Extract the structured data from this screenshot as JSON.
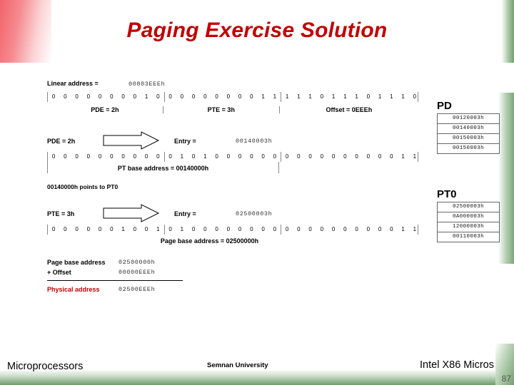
{
  "slide": {
    "title": "Paging Exercise Solution",
    "number": "87"
  },
  "linear_address": {
    "label": "Linear address =",
    "value": "00803EEEh"
  },
  "row1": {
    "bits": [
      "0",
      "0",
      "0",
      "0",
      "0",
      "0",
      "0",
      "0",
      "1",
      "0",
      "0",
      "0",
      "0",
      "0",
      "0",
      "0",
      "0",
      "0",
      "1",
      "1",
      "1",
      "1",
      "1",
      "0",
      "1",
      "1",
      "1",
      "0",
      "1",
      "1",
      "1",
      "0"
    ],
    "fields": [
      {
        "label": "PDE = 2h"
      },
      {
        "label": "PTE = 3h"
      },
      {
        "label": "Offset = 0EEEh"
      }
    ]
  },
  "pde_entry": {
    "label": "PDE = 2h",
    "entry_label": "Entry =",
    "value": "00140003h"
  },
  "row2": {
    "bits": [
      "0",
      "0",
      "0",
      "0",
      "0",
      "0",
      "0",
      "0",
      "0",
      "0",
      "0",
      "1",
      "0",
      "1",
      "0",
      "0",
      "0",
      "0",
      "0",
      "0",
      "0",
      "0",
      "0",
      "0",
      "0",
      "0",
      "0",
      "0",
      "0",
      "0",
      "1",
      "1"
    ],
    "caption": "PT base address = 00140000h"
  },
  "note": "00140000h points to PT0",
  "pte_entry": {
    "label": "PTE = 3h",
    "entry_label": "Entry =",
    "value": "02500003h"
  },
  "row3": {
    "bits": [
      "0",
      "0",
      "0",
      "0",
      "0",
      "0",
      "1",
      "0",
      "0",
      "1",
      "0",
      "1",
      "0",
      "0",
      "0",
      "0",
      "0",
      "0",
      "0",
      "0",
      "0",
      "0",
      "0",
      "0",
      "0",
      "0",
      "0",
      "0",
      "0",
      "0",
      "1",
      "1"
    ],
    "caption": "Page base address = 02500000h"
  },
  "summation": {
    "lines": [
      {
        "name": "Page base address",
        "value": "02500000h"
      },
      {
        "name": "+ Offset",
        "value": "00000EEEh"
      }
    ],
    "total": {
      "name": "Physical address",
      "value": "02500EEEh"
    }
  },
  "pd_table": {
    "title": "PD",
    "entries": [
      "00120003h",
      "00140003h",
      "00150003h",
      "00150003h"
    ]
  },
  "pt0_table": {
    "title": "PT0",
    "entries": [
      "02500003h",
      "0A000003h",
      "12000003h",
      "00110003h"
    ]
  },
  "footer": {
    "left": "Microprocessors",
    "center": "Semnan University",
    "right": "Intel X86 Micros"
  },
  "colors": {
    "title_red": "#c00000",
    "accent_green": "#6f9c6b",
    "accent_red": "#f2636a"
  }
}
